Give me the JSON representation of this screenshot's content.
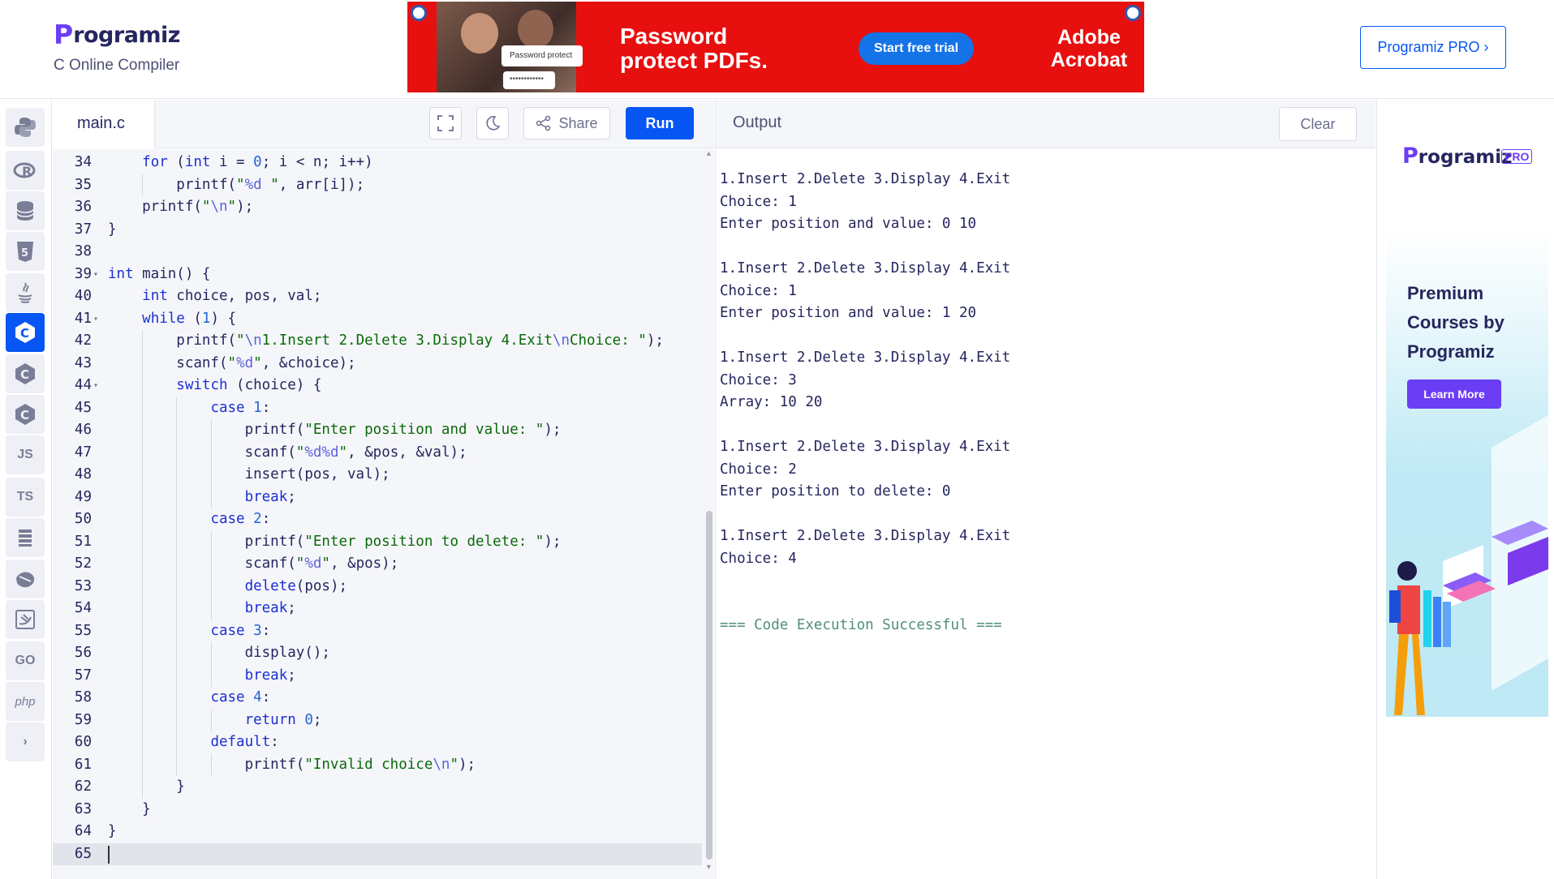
{
  "header": {
    "logo_mark": "P",
    "logo_text": "rogramiz",
    "subtitle": "C Online Compiler",
    "pro_button": "Programiz PRO ›"
  },
  "banner": {
    "password_field_label": "Password protect",
    "password_dots": "••••••••••••",
    "headline": "Password protect PDFs.",
    "cta": "Start free trial",
    "brand": "Adobe Acrobat"
  },
  "rail": {
    "js_label": "JS",
    "ts_label": "TS",
    "go_label": "GO",
    "php_label": "php"
  },
  "editor": {
    "file_tab": "main.c",
    "share_label": "Share",
    "run_label": "Run",
    "lines": [
      {
        "n": "34",
        "fold": "",
        "code": "    for (int i = 0; i < n; i++)"
      },
      {
        "n": "35",
        "fold": "",
        "code": "        printf(\"%d \", arr[i]);"
      },
      {
        "n": "36",
        "fold": "",
        "code": "    printf(\"\\n\");"
      },
      {
        "n": "37",
        "fold": "",
        "code": "}"
      },
      {
        "n": "38",
        "fold": "",
        "code": ""
      },
      {
        "n": "39",
        "fold": "▾",
        "code": "int main() {"
      },
      {
        "n": "40",
        "fold": "",
        "code": "    int choice, pos, val;"
      },
      {
        "n": "41",
        "fold": "▾",
        "code": "    while (1) {"
      },
      {
        "n": "42",
        "fold": "",
        "code": "        printf(\"\\n1.Insert 2.Delete 3.Display 4.Exit\\nChoice: \");"
      },
      {
        "n": "43",
        "fold": "",
        "code": "        scanf(\"%d\", &choice);"
      },
      {
        "n": "44",
        "fold": "▾",
        "code": "        switch (choice) {"
      },
      {
        "n": "45",
        "fold": "",
        "code": "            case 1:"
      },
      {
        "n": "46",
        "fold": "",
        "code": "                printf(\"Enter position and value: \");"
      },
      {
        "n": "47",
        "fold": "",
        "code": "                scanf(\"%d%d\", &pos, &val);"
      },
      {
        "n": "48",
        "fold": "",
        "code": "                insert(pos, val);"
      },
      {
        "n": "49",
        "fold": "",
        "code": "                break;"
      },
      {
        "n": "50",
        "fold": "",
        "code": "            case 2:"
      },
      {
        "n": "51",
        "fold": "",
        "code": "                printf(\"Enter position to delete: \");"
      },
      {
        "n": "52",
        "fold": "",
        "code": "                scanf(\"%d\", &pos);"
      },
      {
        "n": "53",
        "fold": "",
        "code": "                delete(pos);"
      },
      {
        "n": "54",
        "fold": "",
        "code": "                break;"
      },
      {
        "n": "55",
        "fold": "",
        "code": "            case 3:"
      },
      {
        "n": "56",
        "fold": "",
        "code": "                display();"
      },
      {
        "n": "57",
        "fold": "",
        "code": "                break;"
      },
      {
        "n": "58",
        "fold": "",
        "code": "            case 4:"
      },
      {
        "n": "59",
        "fold": "",
        "code": "                return 0;"
      },
      {
        "n": "60",
        "fold": "",
        "code": "            default:"
      },
      {
        "n": "61",
        "fold": "",
        "code": "                printf(\"Invalid choice\\n\");"
      },
      {
        "n": "62",
        "fold": "",
        "code": "        }"
      },
      {
        "n": "63",
        "fold": "",
        "code": "    }"
      },
      {
        "n": "64",
        "fold": "",
        "code": "}"
      },
      {
        "n": "65",
        "fold": "",
        "code": ""
      }
    ]
  },
  "output": {
    "title": "Output",
    "clear_label": "Clear",
    "lines": [
      "1.Insert 2.Delete 3.Display 4.Exit",
      "Choice: 1",
      "Enter position and value: 0 10",
      "",
      "1.Insert 2.Delete 3.Display 4.Exit",
      "Choice: 1",
      "Enter position and value: 1 20",
      "",
      "1.Insert 2.Delete 3.Display 4.Exit",
      "Choice: 3",
      "Array: 10 20",
      "",
      "1.Insert 2.Delete 3.Display 4.Exit",
      "Choice: 2",
      "Enter position to delete: 0",
      "",
      "1.Insert 2.Delete 3.Display 4.Exit",
      "Choice: 4",
      "",
      ""
    ],
    "success": "=== Code Execution Successful ==="
  },
  "side_ad": {
    "logo_mark": "P",
    "logo_text": "rogramiz",
    "badge": "PRO",
    "headline": "Premium Courses by Programiz",
    "cta": "Learn More"
  },
  "colors": {
    "accent": "#0556f3",
    "keyword": "#1b2fd3",
    "string": "#0a6a0a",
    "escape": "#5c62d9",
    "success": "#4f8f7f"
  }
}
